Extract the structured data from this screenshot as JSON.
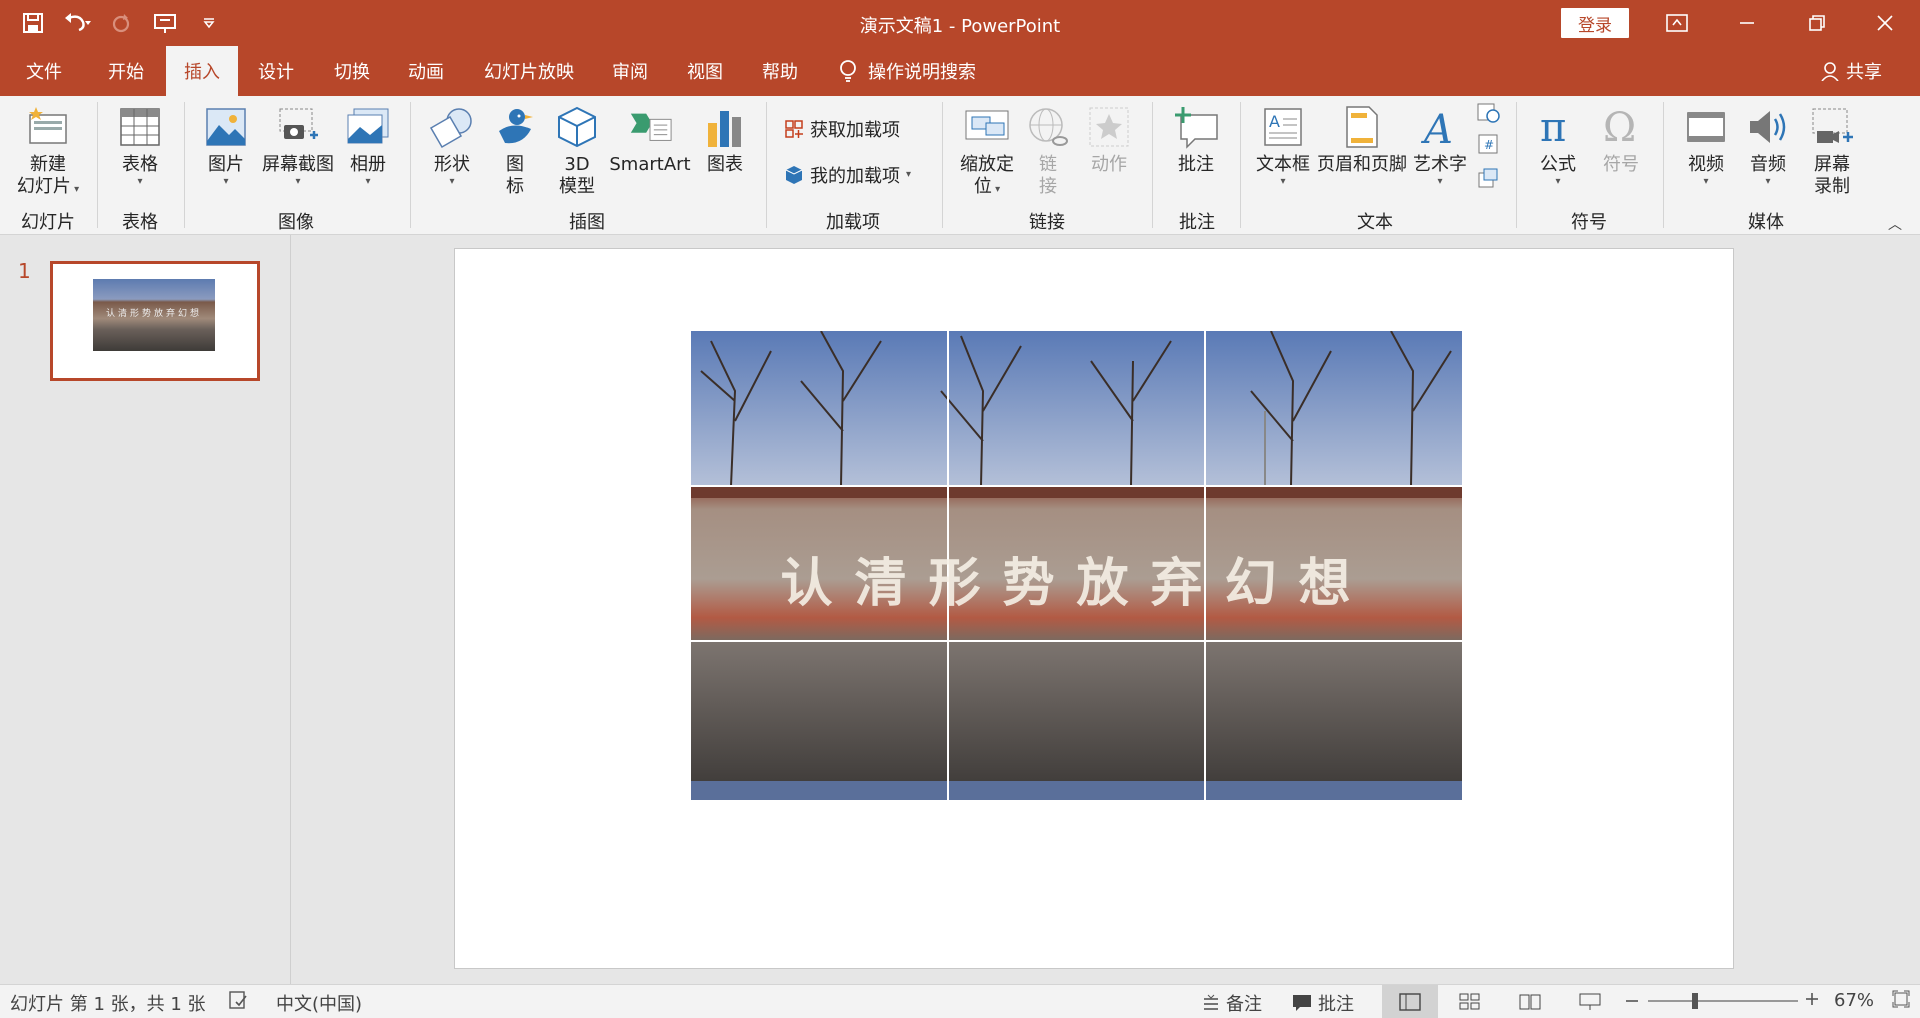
{
  "window": {
    "title": "演示文稿1  -  PowerPoint",
    "signin_label": "登录"
  },
  "tabs": [
    "文件",
    "开始",
    "插入",
    "设计",
    "切换",
    "动画",
    "幻灯片放映",
    "审阅",
    "视图",
    "帮助"
  ],
  "active_tab": "插入",
  "search": {
    "label": "操作说明搜索"
  },
  "share_label": "共享",
  "ribbon": {
    "new_slide": {
      "line1": "新建",
      "line2": "幻灯片"
    },
    "table": "表格",
    "picture": "图片",
    "screenshot": "屏幕截图",
    "album": "相册",
    "shapes": "形状",
    "icons": {
      "line1": "图",
      "line2": "标"
    },
    "model3d": {
      "line1": "3D",
      "line2": "模型"
    },
    "smartart": "SmartArt",
    "chart": "图表",
    "get_addins": "获取加载项",
    "my_addins": "我的加载项",
    "zoom": {
      "line1": "缩放定",
      "line2": "位"
    },
    "link": {
      "line1": "链",
      "line2": "接"
    },
    "action": "动作",
    "comment": "批注",
    "textbox": "文本框",
    "header_footer": "页眉和页脚",
    "wordart": "艺术字",
    "equation": "公式",
    "symbol": "符号",
    "video": "视频",
    "audio": "音频",
    "screen_record": {
      "line1": "屏幕",
      "line2": "录制"
    },
    "groups": {
      "slides": "幻灯片",
      "tables": "表格",
      "images": "图像",
      "illustrations": "插图",
      "addins": "加载项",
      "links": "链接",
      "comments": "批注",
      "text": "文本",
      "symbols": "符号",
      "media": "媒体"
    }
  },
  "thumbnails": [
    {
      "number": "1",
      "mini_text": "认清形势放弃幻想"
    }
  ],
  "slide": {
    "picture_text": "认清形势放弃幻想"
  },
  "status": {
    "slide_info": "幻灯片 第 1 张，共 1 张",
    "language": "中文(中国)",
    "notes": "备注",
    "comments": "批注",
    "zoom": "67%"
  },
  "colors": {
    "accent": "#b7472a"
  }
}
